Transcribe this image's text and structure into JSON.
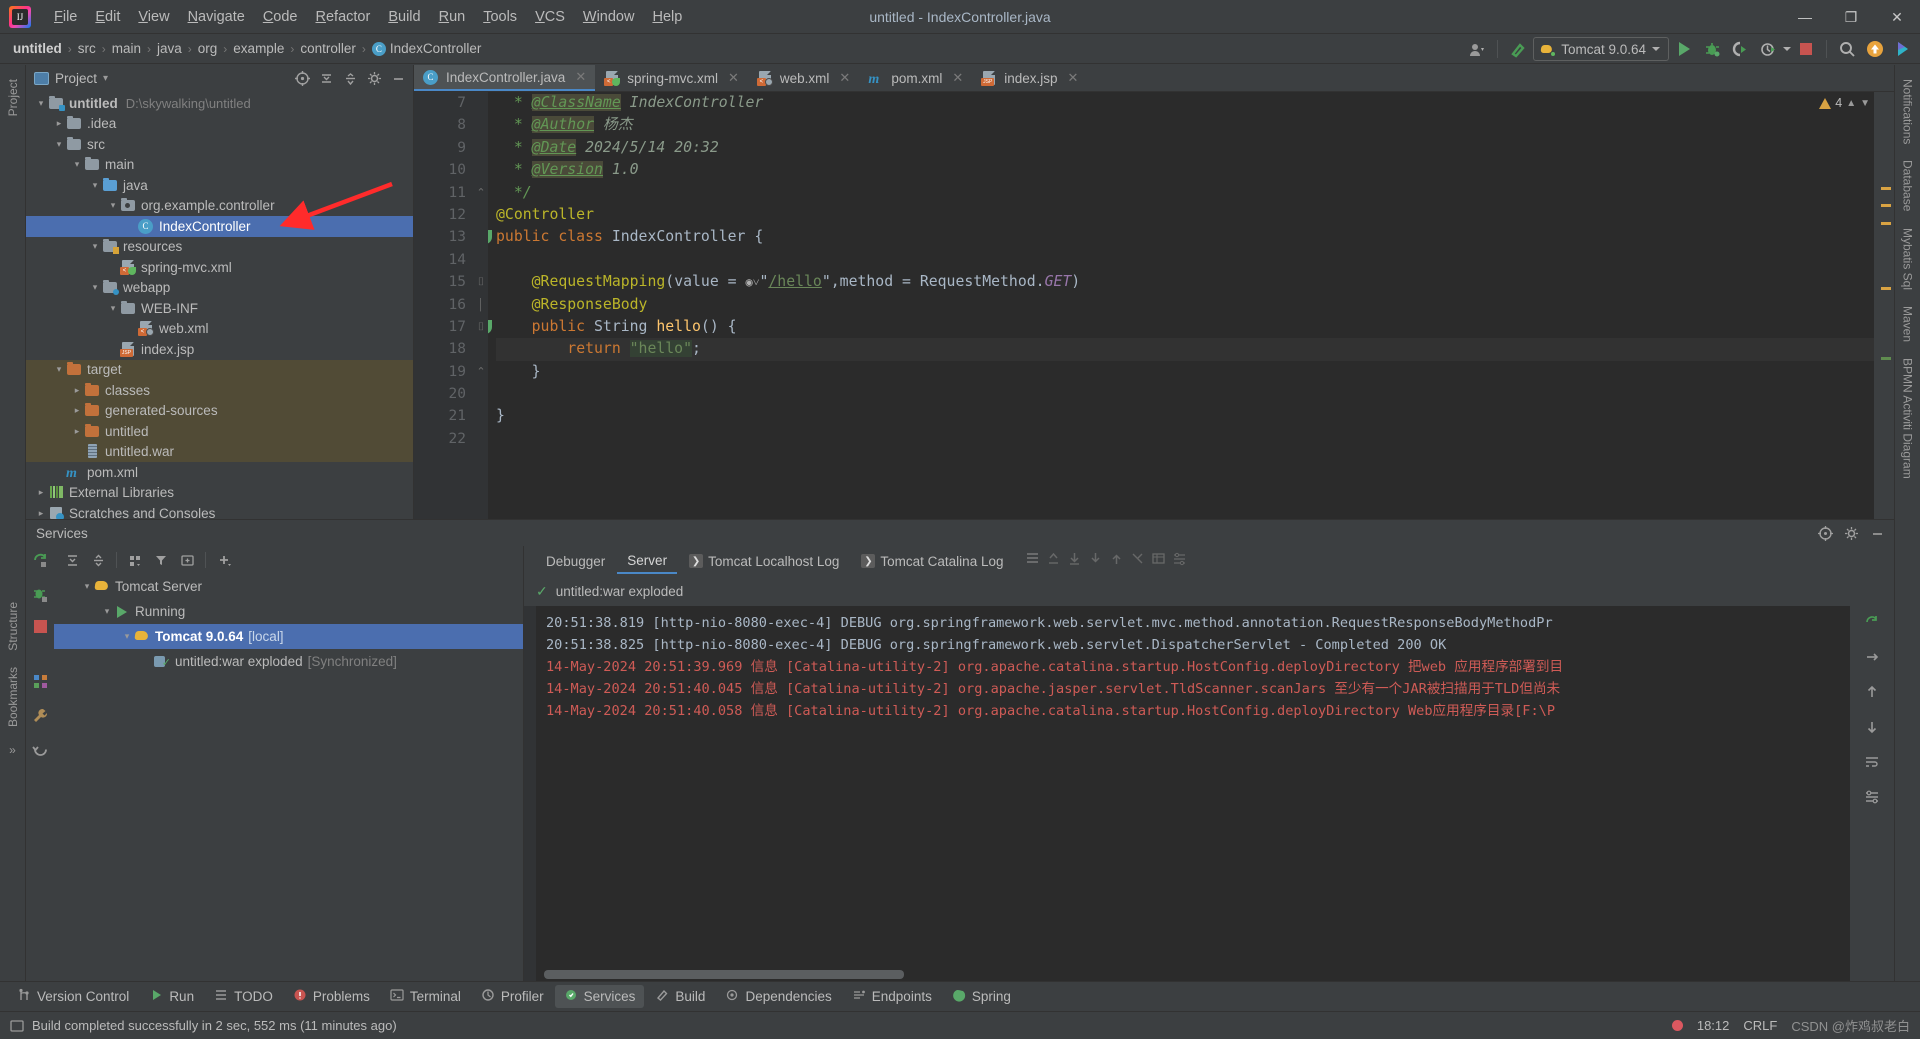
{
  "titlebar": {
    "window_title": "untitled - IndexController.java",
    "menus": [
      "File",
      "Edit",
      "View",
      "Navigate",
      "Code",
      "Refactor",
      "Build",
      "Run",
      "Tools",
      "VCS",
      "Window",
      "Help"
    ],
    "minimize": "—",
    "maximize": "❐",
    "close": "✕"
  },
  "navbar": {
    "breadcrumbs": [
      "untitled",
      "src",
      "main",
      "java",
      "org",
      "example",
      "controller",
      "IndexController"
    ],
    "class_icon_letter": "C",
    "run_config": "Tomcat 9.0.64",
    "icons": {
      "profile": "user-profile-icon",
      "hammer": "build-hammer-icon",
      "run": "run-icon",
      "debug": "debug-icon",
      "run_coverage": "run-with-coverage-icon",
      "profiler": "profiler-icon",
      "stop": "stop-icon",
      "search": "search-everywhere-icon",
      "update": "update-project-icon",
      "ide": "ide-feature-icon"
    }
  },
  "left_strip": {
    "tabs": [
      "Project",
      "Structure",
      "Bookmarks"
    ],
    "more": "»"
  },
  "right_strip": {
    "tabs": [
      "Notifications",
      "Database",
      "Mybatis Sql",
      "Maven",
      "BPMN Activiti Diagram"
    ]
  },
  "project_panel": {
    "title": "Project",
    "chevron": "▾",
    "actions": [
      "select-opened-file-icon",
      "expand-all-icon",
      "collapse-all-icon",
      "settings-gear-icon",
      "hide-icon"
    ],
    "tree": [
      {
        "indent": 0,
        "chevron": "v",
        "icon": "module-folder",
        "label": "untitled",
        "bold": true,
        "path": "D:\\skywalking\\untitled"
      },
      {
        "indent": 1,
        "chevron": ">",
        "icon": "folder",
        "label": ".idea"
      },
      {
        "indent": 1,
        "chevron": "v",
        "icon": "folder",
        "label": "src"
      },
      {
        "indent": 2,
        "chevron": "v",
        "icon": "folder",
        "label": "main"
      },
      {
        "indent": 3,
        "chevron": "v",
        "icon": "source-folder",
        "label": "java"
      },
      {
        "indent": 4,
        "chevron": "v",
        "icon": "package",
        "label": "org.example.controller"
      },
      {
        "indent": 5,
        "chevron": "",
        "icon": "java-class",
        "label": "IndexController",
        "selected": true
      },
      {
        "indent": 3,
        "chevron": "v",
        "icon": "resources-folder",
        "label": "resources"
      },
      {
        "indent": 4,
        "chevron": "",
        "icon": "spring-xml",
        "label": "spring-mvc.xml"
      },
      {
        "indent": 3,
        "chevron": "v",
        "icon": "webapp-folder",
        "label": "webapp"
      },
      {
        "indent": 4,
        "chevron": "v",
        "icon": "folder",
        "label": "WEB-INF"
      },
      {
        "indent": 5,
        "chevron": "",
        "icon": "web-xml",
        "label": "web.xml"
      },
      {
        "indent": 4,
        "chevron": "",
        "icon": "jsp",
        "label": "index.jsp"
      },
      {
        "indent": 1,
        "chevron": "v",
        "icon": "excluded-folder",
        "label": "target",
        "excluded": true
      },
      {
        "indent": 2,
        "chevron": ">",
        "icon": "excluded-folder",
        "label": "classes",
        "excluded": true
      },
      {
        "indent": 2,
        "chevron": ">",
        "icon": "excluded-folder",
        "label": "generated-sources",
        "excluded": true
      },
      {
        "indent": 2,
        "chevron": ">",
        "icon": "excluded-folder",
        "label": "untitled",
        "excluded": true
      },
      {
        "indent": 2,
        "chevron": "",
        "icon": "war-file",
        "label": "untitled.war",
        "excluded": true
      },
      {
        "indent": 1,
        "chevron": "",
        "icon": "maven-pom",
        "label": "pom.xml"
      },
      {
        "indent": 0,
        "chevron": ">",
        "icon": "external-libraries",
        "label": "External Libraries"
      },
      {
        "indent": 0,
        "chevron": ">",
        "icon": "scratches",
        "label": "Scratches and Consoles"
      }
    ]
  },
  "editor": {
    "tabs": [
      {
        "label": "IndexController.java",
        "icon": "java-class",
        "active": true,
        "close": "✕"
      },
      {
        "label": "spring-mvc.xml",
        "icon": "spring-xml",
        "active": false,
        "close": "✕"
      },
      {
        "label": "web.xml",
        "icon": "web-xml",
        "active": false,
        "close": "✕"
      },
      {
        "label": "pom.xml",
        "icon": "maven-pom",
        "active": false,
        "close": "✕"
      },
      {
        "label": "index.jsp",
        "icon": "jsp",
        "active": false,
        "close": "✕"
      }
    ],
    "warning_count": "4",
    "first_line_number": 7,
    "lines": [
      {
        "n": 7,
        "html": "  <span class='cmt'>* </span><span class='tag'>@ClassName</span><span class='cmttxt'> IndexController</span>"
      },
      {
        "n": 8,
        "html": "  <span class='cmt'>* </span><span class='tag'>@Author</span><span class='cmttxt'> 杨杰</span>"
      },
      {
        "n": 9,
        "html": "  <span class='cmt'>* </span><span class='tag'>@Date</span><span class='cmttxt'> 2024/5/14 20:32</span>"
      },
      {
        "n": 10,
        "html": "  <span class='cmt'>* </span><span class='tag'>@Version</span><span class='cmttxt'> 1.0</span>"
      },
      {
        "n": 11,
        "html": "  <span class='cmt'>*/</span>"
      },
      {
        "n": 12,
        "html": "<span class='ann'>@Controller</span>"
      },
      {
        "n": 13,
        "html": "<span class='kw'>public class </span><span class='cls'>IndexController {</span>"
      },
      {
        "n": 14,
        "html": ""
      },
      {
        "n": 15,
        "html": "    <span class='ann'>@RequestMapping</span><span class='cls'>(value = </span><span class='gicon'>◉˅</span><span class='cls'>\"</span><span class='linkstr'>/hello</span><span class='cls'>\",method = RequestMethod.</span><span class='fld2'>GET</span><span class='cls'>)</span>"
      },
      {
        "n": 16,
        "html": "    <span class='ann'>@ResponseBody</span>"
      },
      {
        "n": 17,
        "html": "    <span class='kw'>public </span><span class='cls'>String </span><span class='fn'>hello</span><span class='cls'>() {</span>"
      },
      {
        "n": 18,
        "html": "        <span class='kw'>return </span><span class='str'>\"hello\"</span><span class='cls'>;</span>",
        "highlight": true
      },
      {
        "n": 19,
        "html": "    <span class='cls'>}</span>"
      },
      {
        "n": 20,
        "html": ""
      },
      {
        "n": 21,
        "html": "<span class='cls'>}</span>"
      },
      {
        "n": 22,
        "html": ""
      }
    ]
  },
  "services": {
    "title": "Services",
    "toolbar_icons": [
      "rerun-icon",
      "expand-all-icon",
      "collapse-all-icon",
      "group-by-icon",
      "filter-icon",
      "add-tab-icon",
      "add-service-icon"
    ],
    "side_icons": [
      "rerun-service-icon",
      "debug-service-icon",
      "stop-service-icon",
      "structure-icon",
      "settings-wrench-icon",
      "refresh-icon"
    ],
    "tree": [
      {
        "indent": 0,
        "chevron": "v",
        "icon": "tomcat-icon",
        "label": "Tomcat Server"
      },
      {
        "indent": 1,
        "chevron": "v",
        "icon": "running-icon",
        "label": "Running"
      },
      {
        "indent": 2,
        "chevron": "v",
        "icon": "tomcat-icon",
        "label": "Tomcat 9.0.64",
        "suffix": "[local]",
        "selected": true,
        "bold": true
      },
      {
        "indent": 3,
        "chevron": "",
        "icon": "deploy-ok-icon",
        "label": "untitled:war exploded",
        "suffix": "[Synchronized]"
      }
    ],
    "console_tabs": [
      {
        "label": "Debugger",
        "active": false
      },
      {
        "label": "Server",
        "active": true
      },
      {
        "label": "Tomcat Localhost Log",
        "active": false,
        "icon": "console-icon"
      },
      {
        "label": "Tomcat Catalina Log",
        "active": false,
        "icon": "console-icon"
      }
    ],
    "console_tab_tools": [
      "soft-wrap-icon",
      "scroll-up-icon",
      "down-icon",
      "down-icon",
      "up-icon",
      "cut-icon",
      "print-icon",
      "settings-icon"
    ],
    "deploy_status": "untitled:war exploded",
    "deploy_status_icon": "✓",
    "log_lines": [
      {
        "text": "20:51:38.819 [http-nio-8080-exec-4] DEBUG org.springframework.web.servlet.mvc.method.annotation.RequestResponseBodyMethodPr",
        "level": "debug"
      },
      {
        "text": "20:51:38.825 [http-nio-8080-exec-4] DEBUG org.springframework.web.servlet.DispatcherServlet - Completed 200 OK",
        "level": "debug"
      },
      {
        "text": "14-May-2024 20:51:39.969 信息 [Catalina-utility-2] org.apache.catalina.startup.HostConfig.deployDirectory 把web 应用程序部署到目",
        "level": "error"
      },
      {
        "text": "14-May-2024 20:51:40.045 信息 [Catalina-utility-2] org.apache.jasper.servlet.TldScanner.scanJars 至少有一个JAR被扫描用于TLD但尚未",
        "level": "error"
      },
      {
        "text": "14-May-2024 20:51:40.058 信息 [Catalina-utility-2] org.apache.catalina.startup.HostConfig.deployDirectory Web应用程序目录[F:\\P",
        "level": "error"
      }
    ]
  },
  "toolwindow_bar": {
    "items": [
      {
        "label": "Version Control",
        "icon": "branch-icon"
      },
      {
        "label": "Run",
        "icon": "run-icon"
      },
      {
        "label": "TODO",
        "icon": "todo-icon"
      },
      {
        "label": "Problems",
        "icon": "problems-icon"
      },
      {
        "label": "Terminal",
        "icon": "terminal-icon"
      },
      {
        "label": "Profiler",
        "icon": "profiler-icon"
      },
      {
        "label": "Services",
        "icon": "services-icon",
        "active": true
      },
      {
        "label": "Build",
        "icon": "build-icon"
      },
      {
        "label": "Dependencies",
        "icon": "dependencies-icon"
      },
      {
        "label": "Endpoints",
        "icon": "endpoints-icon"
      },
      {
        "label": "Spring",
        "icon": "spring-icon"
      }
    ]
  },
  "statusbar": {
    "message": "Build completed successfully in 2 sec, 552 ms (11 minutes ago)",
    "icon": "build-status-icon",
    "time": "18:12",
    "encoding": "CRLF",
    "watermark": "CSDN @炸鸡叔老白"
  },
  "colors": {
    "bg": "#3c3f41",
    "editor_bg": "#2b2b2b",
    "selection_blue": "#4b6eaf",
    "accent_blue": "#4a88c7",
    "excluded": "#514b36",
    "error_red": "#cf5b56",
    "green": "#59a869"
  }
}
